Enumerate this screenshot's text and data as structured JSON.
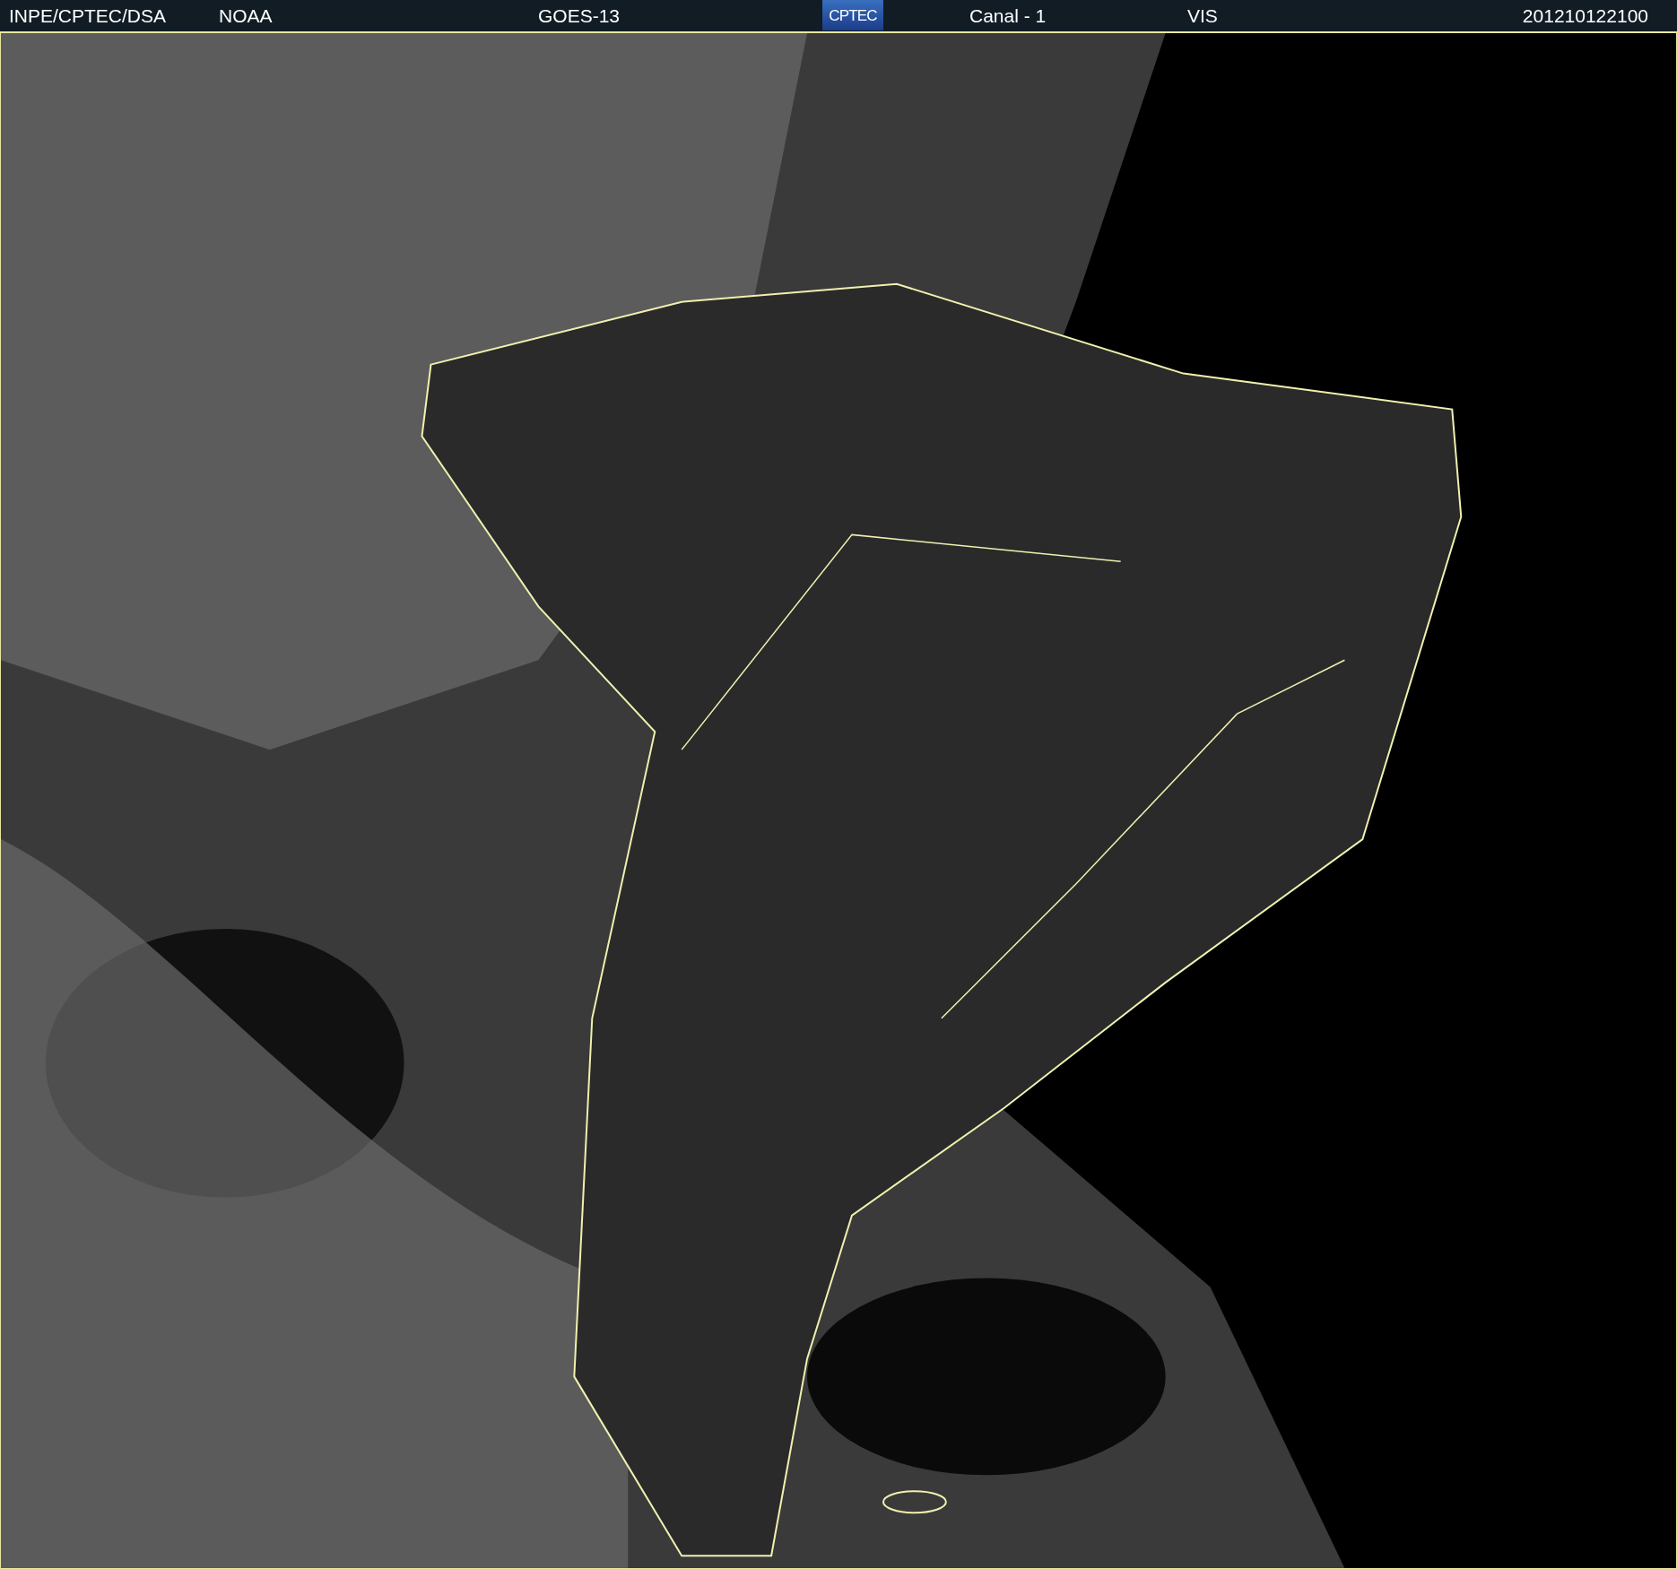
{
  "header": {
    "source": "INPE/CPTEC/DSA",
    "agency": "NOAA",
    "satellite": "GOES-13",
    "logo": "CPTEC",
    "channel": "Canal - 1",
    "band": "VIS",
    "timestamp": "201210122100"
  }
}
